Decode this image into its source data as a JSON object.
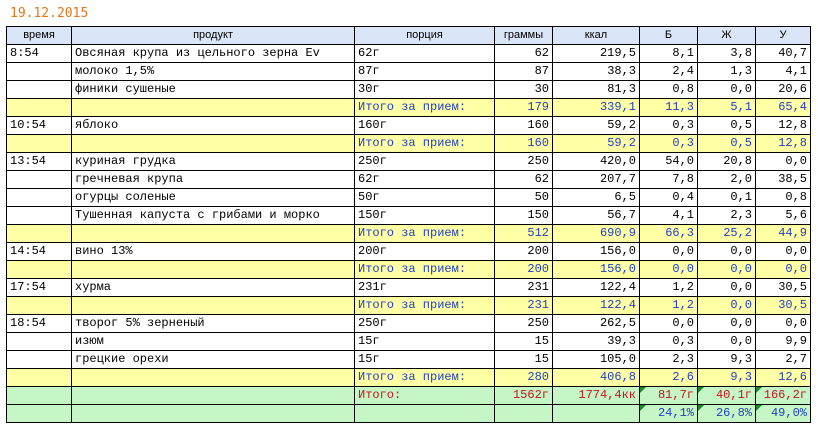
{
  "date": "19.12.2015",
  "headers": [
    "время",
    "продукт",
    "порция",
    "граммы",
    "ккал",
    "Б",
    "Ж",
    "У"
  ],
  "rows": [
    {
      "type": "item",
      "cells": [
        "8:54",
        "Овсяная крупа из цельного зерна Ev",
        "62г",
        "62",
        "219,5",
        "8,1",
        "3,8",
        "40,7"
      ]
    },
    {
      "type": "item",
      "cells": [
        "",
        "молоко 1,5%",
        "87г",
        "87",
        "38,3",
        "2,4",
        "1,3",
        "4,1"
      ]
    },
    {
      "type": "item",
      "cells": [
        "",
        "финики сушеные",
        "30г",
        "30",
        "81,3",
        "0,8",
        "0,0",
        "20,6"
      ]
    },
    {
      "type": "sub",
      "cells": [
        "",
        "",
        "Итого за прием:",
        "179",
        "339,1",
        "11,3",
        "5,1",
        "65,4"
      ]
    },
    {
      "type": "item",
      "cells": [
        "10:54",
        "яблоко",
        "160г",
        "160",
        "59,2",
        "0,3",
        "0,5",
        "12,8"
      ]
    },
    {
      "type": "sub",
      "cells": [
        "",
        "",
        "Итого за прием:",
        "160",
        "59,2",
        "0,3",
        "0,5",
        "12,8"
      ]
    },
    {
      "type": "item",
      "cells": [
        "13:54",
        "куриная грудка",
        "250г",
        "250",
        "420,0",
        "54,0",
        "20,8",
        "0,0"
      ]
    },
    {
      "type": "item",
      "cells": [
        "",
        "гречневая крупа",
        "62г",
        "62",
        "207,7",
        "7,8",
        "2,0",
        "38,5"
      ]
    },
    {
      "type": "item",
      "cells": [
        "",
        "огурцы соленые",
        "50г",
        "50",
        "6,5",
        "0,4",
        "0,1",
        "0,8"
      ]
    },
    {
      "type": "item",
      "cells": [
        "",
        "Тушенная капуста с грибами и морко",
        "150г",
        "150",
        "56,7",
        "4,1",
        "2,3",
        "5,6"
      ]
    },
    {
      "type": "sub",
      "cells": [
        "",
        "",
        "Итого за прием:",
        "512",
        "690,9",
        "66,3",
        "25,2",
        "44,9"
      ]
    },
    {
      "type": "item",
      "cells": [
        "14:54",
        "вино 13%",
        "200г",
        "200",
        "156,0",
        "0,0",
        "0,0",
        "0,0"
      ]
    },
    {
      "type": "sub",
      "cells": [
        "",
        "",
        "Итого за прием:",
        "200",
        "156,0",
        "0,0",
        "0,0",
        "0,0"
      ]
    },
    {
      "type": "item",
      "cells": [
        "17:54",
        "хурма",
        "231г",
        "231",
        "122,4",
        "1,2",
        "0,0",
        "30,5"
      ]
    },
    {
      "type": "sub",
      "cells": [
        "",
        "",
        "Итого за прием:",
        "231",
        "122,4",
        "1,2",
        "0,0",
        "30,5"
      ]
    },
    {
      "type": "item",
      "cells": [
        "18:54",
        "творог 5% зерненый",
        "250г",
        "250",
        "262,5",
        "0,0",
        "0,0",
        "0,0"
      ]
    },
    {
      "type": "item",
      "cells": [
        "",
        "изюм",
        "15г",
        "15",
        "39,3",
        "0,3",
        "0,0",
        "9,9"
      ]
    },
    {
      "type": "item",
      "cells": [
        "",
        "грецкие орехи",
        "15г",
        "15",
        "105,0",
        "2,3",
        "9,3",
        "2,7"
      ]
    },
    {
      "type": "sub",
      "cells": [
        "",
        "",
        "Итого за прием:",
        "280",
        "406,8",
        "2,6",
        "9,3",
        "12,6"
      ]
    },
    {
      "type": "tot",
      "cells": [
        "",
        "",
        "Итого:",
        "1562г",
        "1774,4кк",
        "81,7г",
        "40,1г",
        "166,2г"
      ]
    },
    {
      "type": "pct",
      "cells": [
        "",
        "",
        "",
        "",
        "",
        "24,1%",
        "26,8%",
        "49,0%"
      ]
    }
  ],
  "colors": {
    "header": "#dae6f7",
    "subtotal": "#ffffa6",
    "total": "#c6f5c6",
    "date": "#e0781e",
    "blue_text": "#1f3fc8",
    "red_text": "#c8141e"
  }
}
